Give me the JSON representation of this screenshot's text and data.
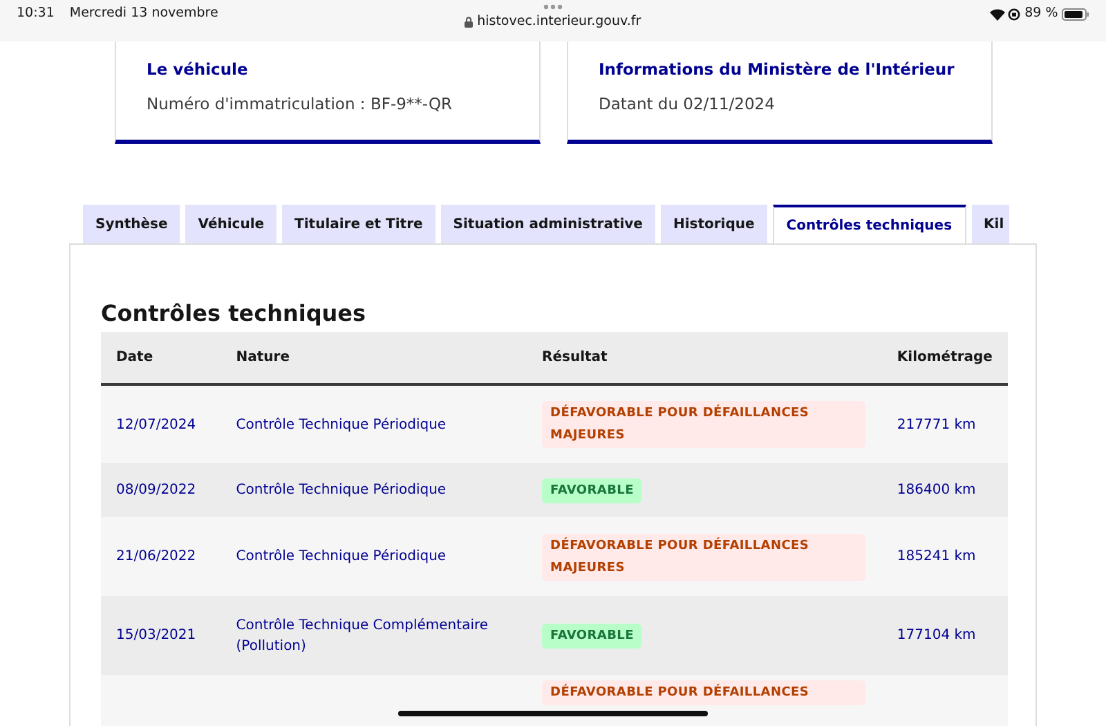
{
  "status_bar": {
    "time": "10:31",
    "date": "Mercredi 13 novembre",
    "url": "histovec.interieur.gouv.fr",
    "battery": "89 %"
  },
  "cards": [
    {
      "title": "Le véhicule",
      "text": "Numéro d'immatriculation : BF-9**-QR"
    },
    {
      "title": "Informations du Ministère de l'Intérieur",
      "text": "Datant du 02/11/2024"
    }
  ],
  "tabs": [
    {
      "label": "Synthèse",
      "selected": false
    },
    {
      "label": "Véhicule",
      "selected": false
    },
    {
      "label": "Titulaire et Titre",
      "selected": false
    },
    {
      "label": "Situation administrative",
      "selected": false
    },
    {
      "label": "Historique",
      "selected": false
    },
    {
      "label": "Contrôles techniques",
      "selected": true
    },
    {
      "label": "Kil",
      "selected": false
    }
  ],
  "section_title": "Contrôles techniques",
  "table": {
    "columns": [
      "Date",
      "Nature",
      "Résultat",
      "Kilométrage"
    ],
    "rows": [
      {
        "date": "12/07/2024",
        "nature": "Contrôle Technique Périodique",
        "result": {
          "text": "DÉFAVORABLE POUR DÉFAILLANCES MAJEURES",
          "kind": "unfavorable"
        },
        "km": "217771 km"
      },
      {
        "date": "08/09/2022",
        "nature": "Contrôle Technique Périodique",
        "result": {
          "text": "FAVORABLE",
          "kind": "favorable"
        },
        "km": "186400 km"
      },
      {
        "date": "21/06/2022",
        "nature": "Contrôle Technique Périodique",
        "result": {
          "text": "DÉFAVORABLE POUR DÉFAILLANCES MAJEURES",
          "kind": "unfavorable"
        },
        "km": "185241 km"
      },
      {
        "date": "15/03/2021",
        "nature": "Contrôle Technique Complémentaire (Pollution)",
        "result": {
          "text": "FAVORABLE",
          "kind": "favorable"
        },
        "km": "177104 km"
      },
      {
        "result": {
          "text": "DÉFAVORABLE POUR DÉFAILLANCES",
          "kind": "unfavorable"
        }
      }
    ]
  }
}
